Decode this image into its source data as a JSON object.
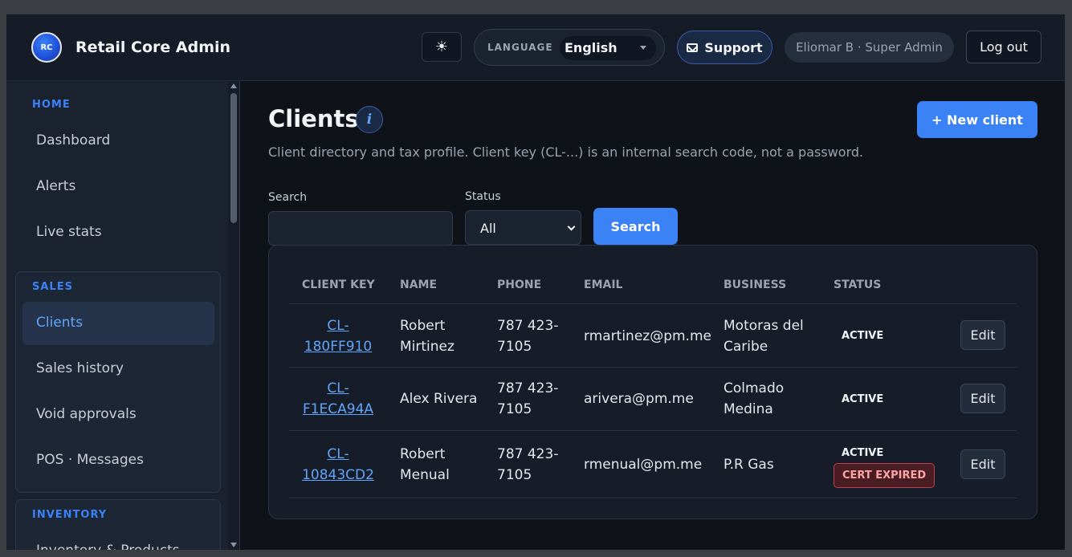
{
  "header": {
    "brand": "Retail Core Admin",
    "logo_text": "RC",
    "theme_icon": "☀",
    "language_label": "LANGUAGE",
    "language_value": "English",
    "support_label": "Support",
    "user_label": "Eliomar B · Super Admin",
    "logout_label": "Log out"
  },
  "sidebar": {
    "home_heading": "HOME",
    "home_items": [
      "Dashboard",
      "Alerts",
      "Live stats"
    ],
    "sales_heading": "SALES",
    "sales_items": [
      "Clients",
      "Sales history",
      "Void approvals",
      "POS · Messages"
    ],
    "inventory_heading": "INVENTORY",
    "inventory_partial": "Inventory & Products"
  },
  "main": {
    "title": "Clients",
    "info_icon": "i",
    "subtitle": "Client directory and tax profile. Client key (CL-...) is an internal search code, not a password.",
    "new_button": "+ New client",
    "search_label": "Search",
    "search_value": "",
    "status_label": "Status",
    "status_value": "All",
    "search_button": "Search"
  },
  "table": {
    "columns": [
      "CLIENT KEY",
      "NAME",
      "PHONE",
      "EMAIL",
      "BUSINESS",
      "STATUS"
    ],
    "rows": [
      {
        "key_1": "CL-",
        "key_2": "180FF910",
        "name_1": "Robert",
        "name_2": "Mirtinez",
        "phone_1": "787 423-",
        "phone_2": "7105",
        "email": "rmartinez@pm.me",
        "business_1": "Motoras del",
        "business_2": "Caribe",
        "status": "ACTIVE",
        "cert": "",
        "action": "Edit"
      },
      {
        "key_1": "CL-",
        "key_2": "F1ECA94A",
        "name_1": "Alex Rivera",
        "name_2": "",
        "phone_1": "787 423-",
        "phone_2": "7105",
        "email": "arivera@pm.me",
        "business_1": "Colmado",
        "business_2": "Medina",
        "status": "ACTIVE",
        "cert": "",
        "action": "Edit"
      },
      {
        "key_1": "CL-",
        "key_2": "10843CD2",
        "name_1": "Robert",
        "name_2": "Menual",
        "phone_1": "787 423-",
        "phone_2": "7105",
        "email": "rmenual@pm.me",
        "business_1": "P.R Gas",
        "business_2": "",
        "status": "ACTIVE",
        "cert": "CERT EXPIRED",
        "action": "Edit"
      }
    ]
  },
  "colors": {
    "accent": "#3b82f6",
    "background": "#0f1319",
    "danger": "#b84250"
  }
}
